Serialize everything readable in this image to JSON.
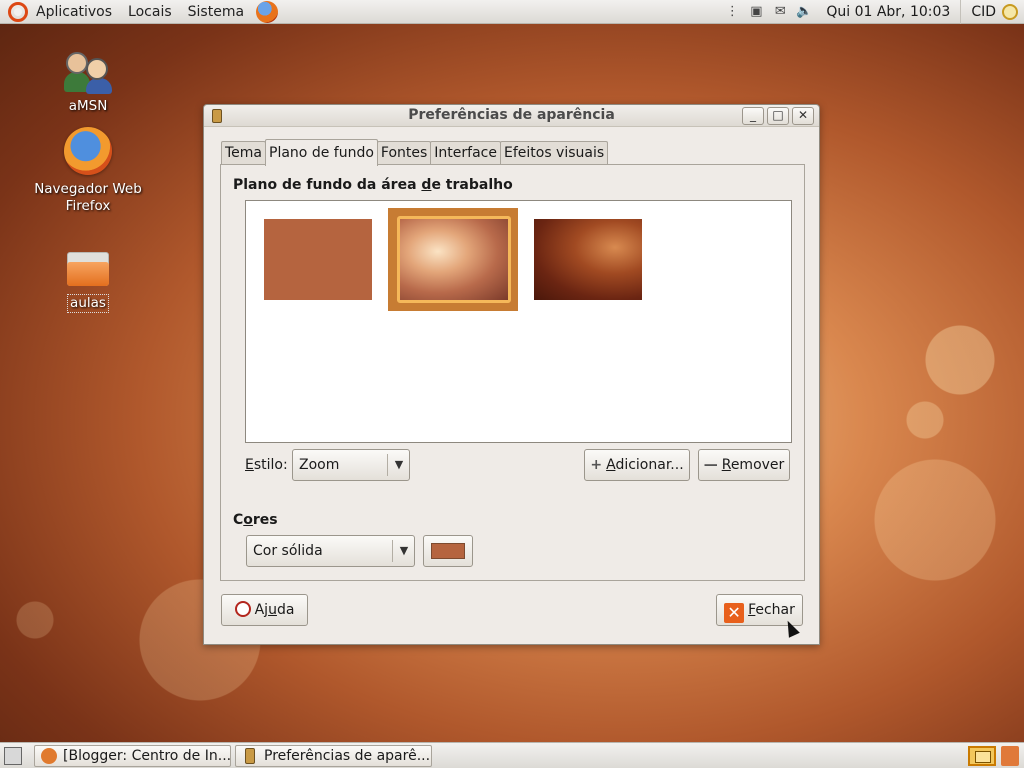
{
  "top_panel": {
    "menus": [
      "Aplicativos",
      "Locais",
      "Sistema"
    ],
    "clock": "Qui 01 Abr, 10:03",
    "user": "CID"
  },
  "desktop": {
    "icons": [
      {
        "label": "aMSN",
        "icon": "amsn-icon"
      },
      {
        "label": "Navegador Web Firefox",
        "icon": "firefox-icon"
      },
      {
        "label": "aulas",
        "icon": "folder-icon"
      }
    ]
  },
  "dialog": {
    "title": "Preferências de aparência",
    "tabs": [
      "Tema",
      "Plano de fundo",
      "Fontes",
      "Interface",
      "Efeitos visuais"
    ],
    "active_tab": "Plano de fundo",
    "wallpaper_section": {
      "title_before": "Plano de fundo da área ",
      "title_underlined": "d",
      "title_after": "e trabalho",
      "wallpapers": [
        "solid-color",
        "ubuntu-warm-bokeh",
        "ubuntu-dark-gradient"
      ],
      "selected_index": 1
    },
    "style": {
      "label_underlined": "E",
      "label_rest": "stilo:",
      "value": "Zoom"
    },
    "add_button": {
      "underlined": "A",
      "rest": "dicionar..."
    },
    "remove_button": {
      "underlined": "R",
      "rest": "emover"
    },
    "colors": {
      "title_first": "C",
      "title_underlined": "o",
      "title_rest": "res",
      "mode": "Cor sólida",
      "swatch_color": "#b5643f"
    },
    "help_button": {
      "before": "Aj",
      "underlined": "u",
      "after": "da"
    },
    "close_button": {
      "underlined": "F",
      "rest": "echar"
    }
  },
  "bottom_panel": {
    "tasks": [
      "[Blogger: Centro de In...",
      "Preferências de aparê..."
    ]
  }
}
